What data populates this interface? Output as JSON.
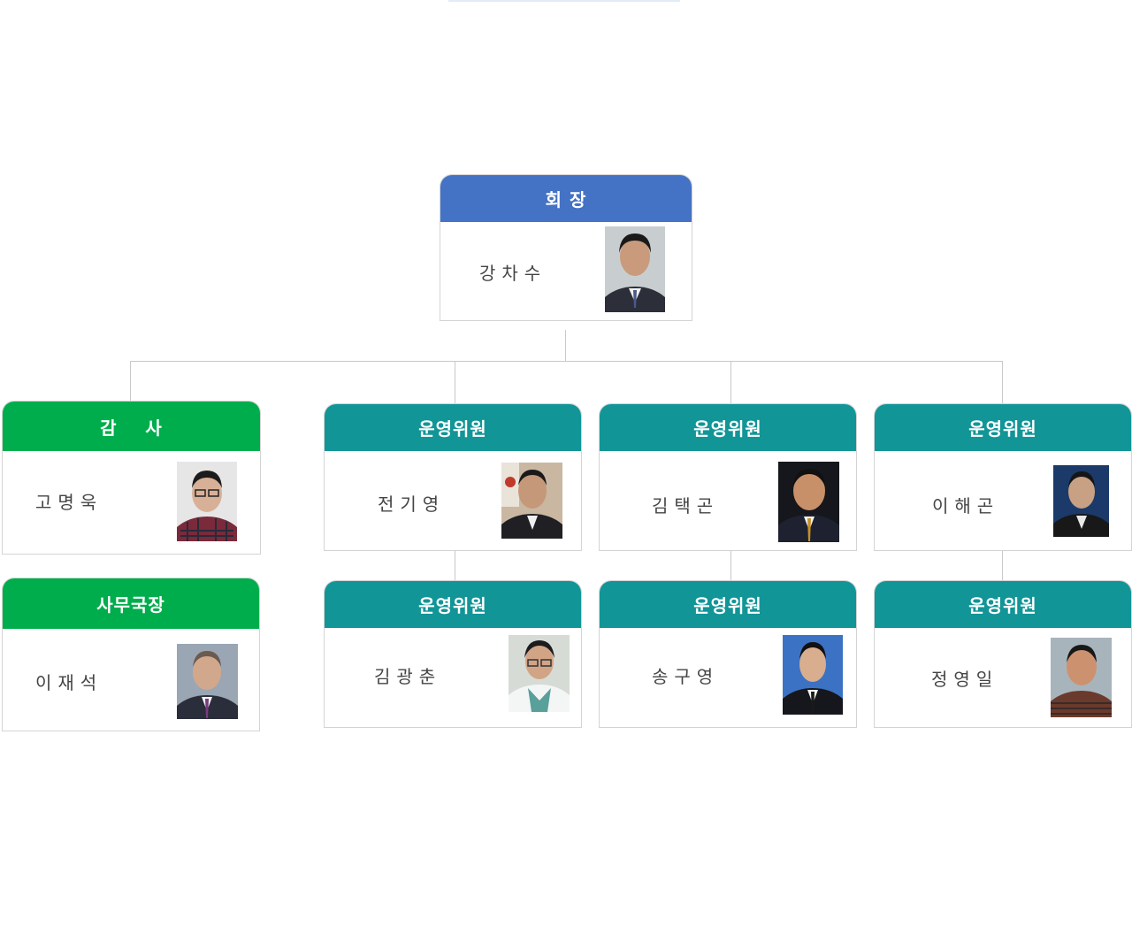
{
  "chairman": {
    "title": "회 장",
    "name": "강차수"
  },
  "auditor": {
    "title": "감    사",
    "name": "고명욱"
  },
  "secretary_general": {
    "title": "사무국장",
    "name": "이재석"
  },
  "committee": [
    {
      "title": "운영위원",
      "name": "전기영"
    },
    {
      "title": "운영위원",
      "name": "김택곤"
    },
    {
      "title": "운영위원",
      "name": "이해곤"
    },
    {
      "title": "운영위원",
      "name": "김광춘"
    },
    {
      "title": "운영위원",
      "name": "송구영"
    },
    {
      "title": "운영위원",
      "name": "정영일"
    }
  ],
  "colors": {
    "chairman_header": "#4472c4",
    "executive_header": "#00ad4c",
    "committee_header": "#129597",
    "connector": "#c9c9c9"
  }
}
